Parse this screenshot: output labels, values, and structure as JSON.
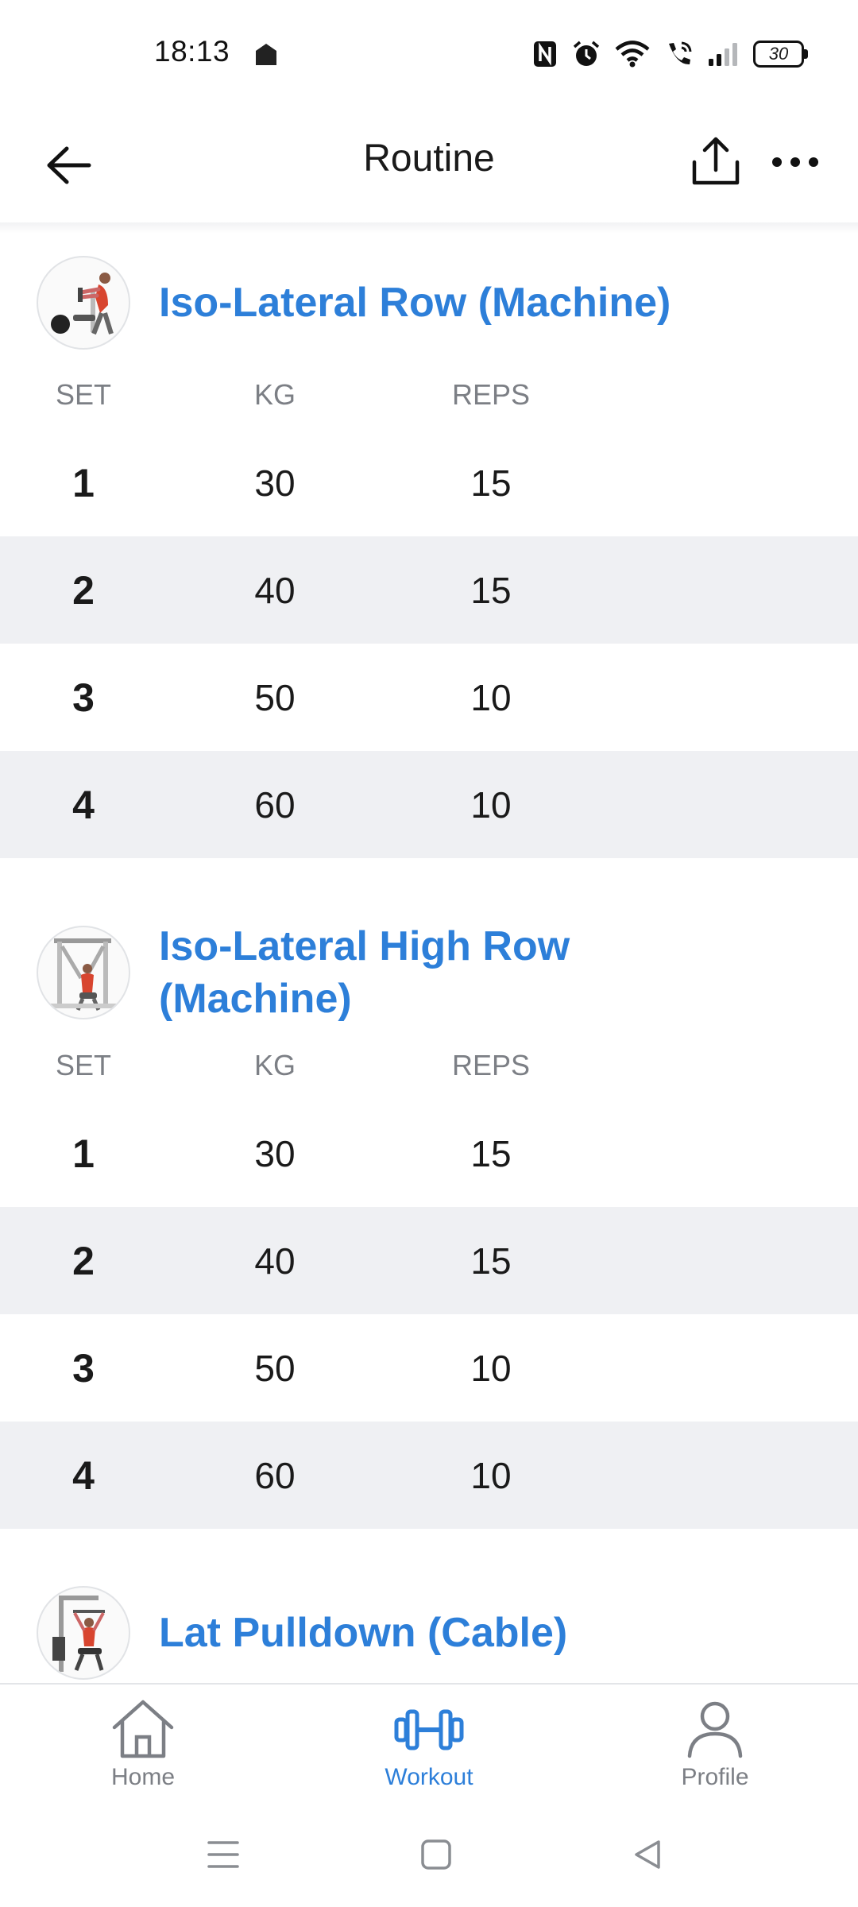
{
  "status_bar": {
    "time": "18:13",
    "battery": "30"
  },
  "header": {
    "title": "Routine"
  },
  "table_headers": {
    "set": "SET",
    "kg": "KG",
    "reps": "REPS"
  },
  "exercises": [
    {
      "name": "Iso-Lateral Row (Machine)",
      "sets": [
        {
          "set": "1",
          "kg": "30",
          "reps": "15"
        },
        {
          "set": "2",
          "kg": "40",
          "reps": "15"
        },
        {
          "set": "3",
          "kg": "50",
          "reps": "10"
        },
        {
          "set": "4",
          "kg": "60",
          "reps": "10"
        }
      ]
    },
    {
      "name_line1": "Iso-Lateral High Row",
      "name_line2": "(Machine)",
      "sets": [
        {
          "set": "1",
          "kg": "30",
          "reps": "15"
        },
        {
          "set": "2",
          "kg": "40",
          "reps": "15"
        },
        {
          "set": "3",
          "kg": "50",
          "reps": "10"
        },
        {
          "set": "4",
          "kg": "60",
          "reps": "10"
        }
      ]
    },
    {
      "name": "Lat Pulldown (Cable)"
    }
  ],
  "bottom_nav": {
    "items": [
      {
        "label": "Home",
        "icon": "home-icon"
      },
      {
        "label": "Workout",
        "icon": "dumbbell-icon",
        "active": true
      },
      {
        "label": "Profile",
        "icon": "person-icon"
      }
    ]
  },
  "colors": {
    "accent": "#2d7fd9",
    "row_alt": "#eff0f3",
    "muted": "#7c7f85"
  }
}
